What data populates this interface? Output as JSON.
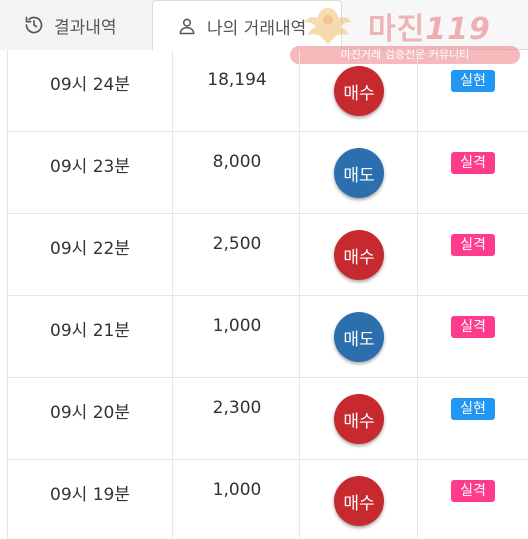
{
  "tabs": {
    "results": {
      "label": "결과내역",
      "icon": "history-icon"
    },
    "my_trades": {
      "label": "나의 거래내역",
      "icon": "user-icon",
      "active": true
    }
  },
  "watermark": {
    "title": "마진",
    "title_number": "119",
    "subtitle": "마진거래 검증전문 커뮤니티"
  },
  "colors": {
    "buy": "#c62a2f",
    "sell": "#2b6fae",
    "win": "#2196f3",
    "lose": "#ff3b8d"
  },
  "rows": [
    {
      "time": "09시 24분",
      "amount": "18,194",
      "side": "매수",
      "side_type": "buy",
      "result": "실현",
      "result_type": "win"
    },
    {
      "time": "09시 23분",
      "amount": "8,000",
      "side": "매도",
      "side_type": "sell",
      "result": "실격",
      "result_type": "lose"
    },
    {
      "time": "09시 22분",
      "amount": "2,500",
      "side": "매수",
      "side_type": "buy",
      "result": "실격",
      "result_type": "lose"
    },
    {
      "time": "09시 21분",
      "amount": "1,000",
      "side": "매도",
      "side_type": "sell",
      "result": "실격",
      "result_type": "lose"
    },
    {
      "time": "09시 20분",
      "amount": "2,300",
      "side": "매수",
      "side_type": "buy",
      "result": "실현",
      "result_type": "win"
    },
    {
      "time": "09시 19분",
      "amount": "1,000",
      "side": "매수",
      "side_type": "buy",
      "result": "실격",
      "result_type": "lose"
    }
  ]
}
